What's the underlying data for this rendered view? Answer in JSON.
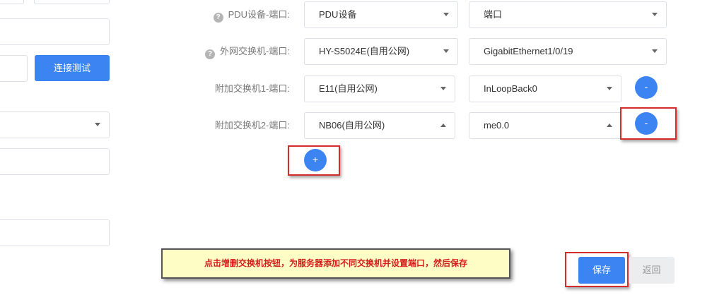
{
  "left_panel": {
    "test_connection_label": "连接测试"
  },
  "rows": [
    {
      "label": "PDU设备-端口:",
      "has_help": true,
      "device": "PDU设备",
      "port": "端口"
    },
    {
      "label": "外网交换机-端口:",
      "has_help": true,
      "device": "HY-S5024E(自用公网)",
      "port": "GigabitEthernet1/0/19"
    },
    {
      "label": "附加交换机1-端口:",
      "has_help": false,
      "device": "E11(自用公网)",
      "port": "InLoopBack0",
      "remove_label": "-"
    },
    {
      "label": "附加交换机2-端口:",
      "has_help": false,
      "device": "NB06(自用公网)",
      "port": "me0.0",
      "remove_label": "-"
    }
  ],
  "add_switch_label": "+",
  "help_icon_glyph": "?",
  "tip_text": "点击增删交换机按钮，为服务器添加不同交换机并设置端口，然后保存",
  "footer": {
    "save_label": "保存",
    "back_label": "返回"
  },
  "colors": {
    "primary": "#3c84f1",
    "highlight": "#d62b2b",
    "tip_bg": "#fffdc6",
    "tip_text": "#d61b1b"
  }
}
